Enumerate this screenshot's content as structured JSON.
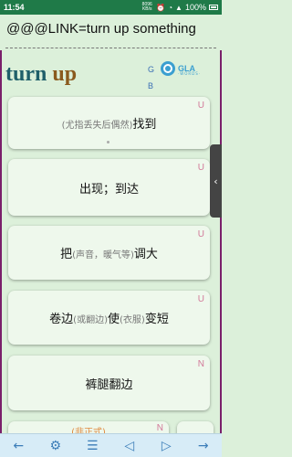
{
  "status_bar": {
    "time": "11:54",
    "speed": "8096 KB/s",
    "battery": "100%"
  },
  "header": {
    "title": "@@@LINK=turn up something"
  },
  "entry": {
    "word_part1": "turn",
    "word_part2": "up",
    "gb_label_1": "G",
    "gb_label_2": "B",
    "logo_text": "GLA",
    "logo_sub": "·WORDS·"
  },
  "cards": [
    {
      "badge": "U",
      "parts": [
        {
          "t": "(尤指丢失后偶然)",
          "small": true
        },
        {
          "t": "找到",
          "small": false
        }
      ]
    },
    {
      "badge": "U",
      "parts": [
        {
          "t": "出现；到达",
          "small": false
        }
      ]
    },
    {
      "badge": "U",
      "parts": [
        {
          "t": "把",
          "small": false
        },
        {
          "t": "(声音，暖气等)",
          "small": true
        },
        {
          "t": "调大",
          "small": false
        }
      ]
    },
    {
      "badge": "U",
      "parts": [
        {
          "t": "卷边",
          "small": false
        },
        {
          "t": "(或翻边)",
          "small": true
        },
        {
          "t": "使",
          "small": false
        },
        {
          "t": "(衣服)",
          "small": true
        },
        {
          "t": "变短",
          "small": false
        }
      ]
    },
    {
      "badge": "N",
      "parts": [
        {
          "t": "裤腿翻边",
          "small": false
        }
      ]
    }
  ],
  "partial_card": {
    "text": "(非正式)",
    "badge": "N"
  },
  "side_handle_glyph": "‹",
  "bottom_nav": [
    {
      "icon": "back-arrow-icon",
      "glyph": "←"
    },
    {
      "icon": "settings-icon",
      "glyph": "⚙"
    },
    {
      "icon": "list-icon",
      "glyph": "☰"
    },
    {
      "icon": "prev-icon",
      "glyph": "◁"
    },
    {
      "icon": "next-icon",
      "glyph": "▷"
    },
    {
      "icon": "forward-arrow-icon",
      "glyph": "→"
    }
  ]
}
